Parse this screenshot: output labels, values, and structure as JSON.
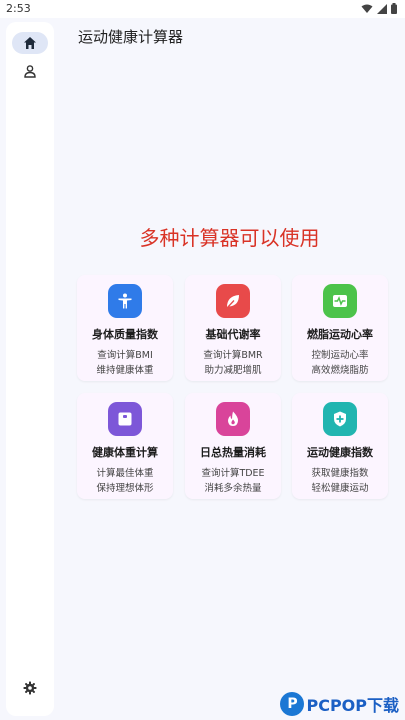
{
  "status_bar": {
    "time": "2:53"
  },
  "rail": {
    "items": [
      {
        "icon": "home-icon",
        "active": true
      },
      {
        "icon": "person-icon",
        "active": false
      }
    ],
    "settings_icon": "gear-icon"
  },
  "app_title": "运动健康计算器",
  "hero_text": "多种计算器可以使用",
  "cards": [
    {
      "title": "身体质量指数",
      "line1": "查询计算BMI",
      "line2": "维持健康体重",
      "color": "#2f7be9",
      "icon": "accessibility-icon"
    },
    {
      "title": "基础代谢率",
      "line1": "查询计算BMR",
      "line2": "助力减肥增肌",
      "color": "#e84a4a",
      "icon": "leaf-icon"
    },
    {
      "title": "燃脂运动心率",
      "line1": "控制运动心率",
      "line2": "高效燃烧脂肪",
      "color": "#4cc34a",
      "icon": "heart-monitor-icon"
    },
    {
      "title": "健康体重计算",
      "line1": "计算最佳体重",
      "line2": "保持理想体形",
      "color": "#7d57d8",
      "icon": "scale-icon"
    },
    {
      "title": "日总热量消耗",
      "line1": "查询计算TDEE",
      "line2": "消耗多余热量",
      "color": "#d9449a",
      "icon": "flame-icon"
    },
    {
      "title": "运动健康指数",
      "line1": "获取健康指数",
      "line2": "轻松健康运动",
      "color": "#21b5b0",
      "icon": "shield-plus-icon"
    }
  ],
  "watermark": {
    "text": "PCPOP下载"
  }
}
